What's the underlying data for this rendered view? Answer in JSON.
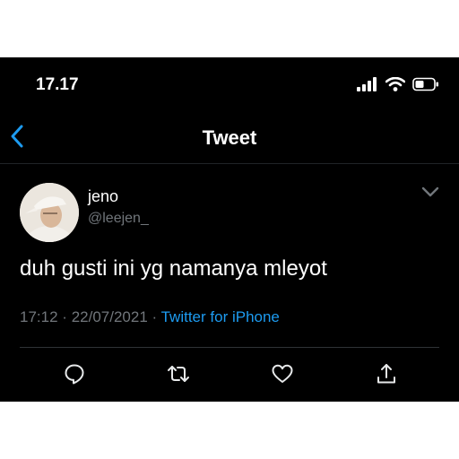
{
  "status_bar": {
    "time": "17.17",
    "icons": [
      "signal-icon",
      "wifi-icon",
      "battery-icon"
    ]
  },
  "nav": {
    "back_icon": "chevron-left-icon",
    "title": "Tweet"
  },
  "tweet": {
    "author": {
      "display_name": "jeno",
      "handle": "@leejen_"
    },
    "text": "duh gusti ini yg namanya mleyot",
    "time": "17:12",
    "separator": "·",
    "date": "22/07/2021",
    "source": "Twitter for iPhone",
    "menu_icon": "chevron-down-icon"
  },
  "actions": [
    "reply-icon",
    "retweet-icon",
    "like-icon",
    "share-icon"
  ],
  "colors": {
    "background": "#000000",
    "text_primary": "#ffffff",
    "text_secondary": "#71767b",
    "accent": "#1d9bf0",
    "divider": "#2f3336"
  }
}
